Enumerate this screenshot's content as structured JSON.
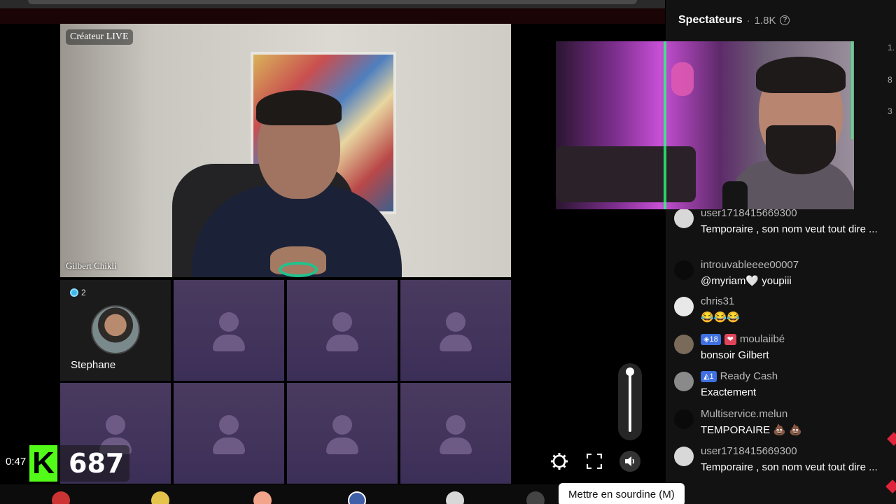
{
  "host": {
    "badge": "Créateur LIVE",
    "name": "Gilbert Chikli"
  },
  "guest": {
    "name": "Stephane",
    "count": "2"
  },
  "score": {
    "timer": "0:47",
    "k_logo": "K",
    "value": "687"
  },
  "controls": {
    "tooltip": "Mettre en sourdine (M)"
  },
  "panel": {
    "title": "Spectateurs",
    "separator": "·",
    "count": "1.8K",
    "edge_numbers": [
      "1.",
      "8",
      "3"
    ]
  },
  "chat": [
    {
      "user": "user1718415669300",
      "text": "Temporaire , son nom veut tout dire ...",
      "avatar_color": "#d8d8d8"
    },
    {
      "user": "introuvableeee00007",
      "text": "@myriam🤍 youpiii",
      "avatar_color": "#0a0a0a"
    },
    {
      "user": "chris31",
      "text": "😂😂😂",
      "avatar_color": "#e8e8e8"
    },
    {
      "user": "moulaiibé",
      "text": "bonsoir Gilbert",
      "badges": [
        "◈18",
        "❤"
      ],
      "avatar_color": "#7a6a5a"
    },
    {
      "user": "Ready Cash",
      "text": "Exactement",
      "badges": [
        "◭1"
      ],
      "avatar_color": "#8a8a8a"
    },
    {
      "user": "Multiservice.melun",
      "text": "TEMPORAIRE 💩 💩",
      "avatar_color": "#0a0a0a"
    },
    {
      "user": "user1718415669300",
      "text": "Temporaire , son nom veut tout dire ...",
      "avatar_color": "#d8d8d8"
    }
  ],
  "colors": {
    "kick_green": "#53fc18",
    "panel_bg": "#121212",
    "tile_purple": "#3c2f57"
  },
  "icons": [
    "settings-icon",
    "fullscreen-icon",
    "mute-icon",
    "help-icon"
  ]
}
